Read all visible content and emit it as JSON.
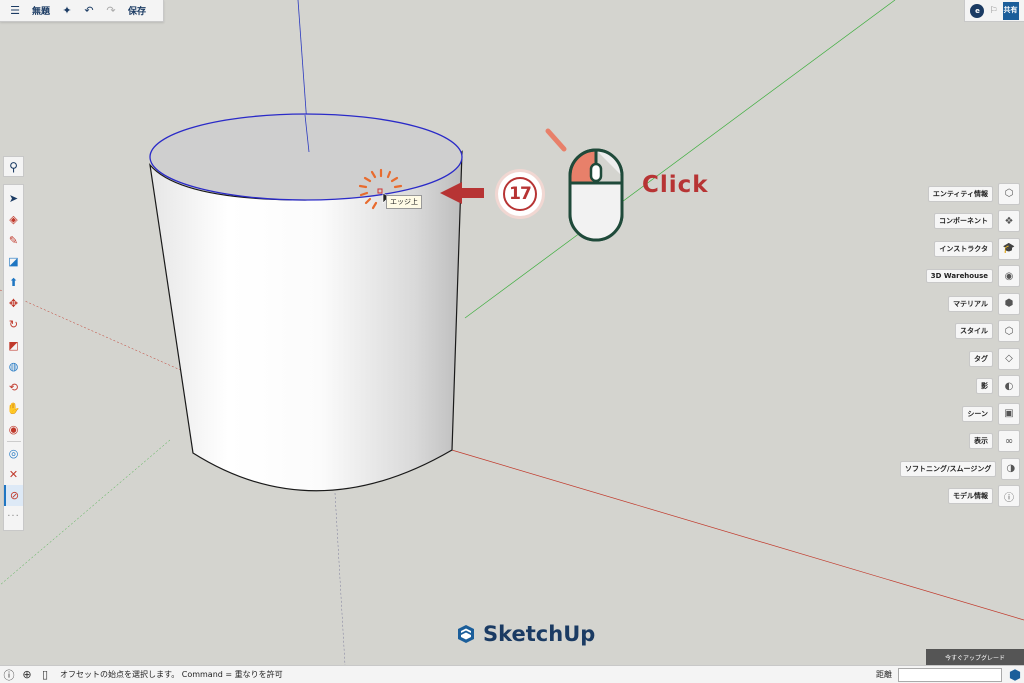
{
  "toolbar": {
    "menu_icon": "menu-icon",
    "title": "無題",
    "save_label": "保存"
  },
  "header_right": {
    "avatar_initial": "e",
    "share_label": "共有"
  },
  "left_tools": [
    {
      "name": "select-tool-icon",
      "glyph": "➤"
    },
    {
      "name": "eraser-tool-icon",
      "glyph": "◈"
    },
    {
      "name": "pencil-tool-icon",
      "glyph": "✎"
    },
    {
      "name": "rectangle-tool-icon",
      "glyph": "◪"
    },
    {
      "name": "push-pull-tool-icon",
      "glyph": "⬆"
    },
    {
      "name": "move-tool-icon",
      "glyph": "✥"
    },
    {
      "name": "rotate-tool-icon",
      "glyph": "↻"
    },
    {
      "name": "scale-tool-icon",
      "glyph": "◩"
    },
    {
      "name": "paint-bucket-tool-icon",
      "glyph": "◍"
    },
    {
      "name": "orbit-tool-icon",
      "glyph": "⟲"
    },
    {
      "name": "pan-tool-icon",
      "glyph": "✋"
    },
    {
      "name": "position-camera-icon",
      "glyph": "◉"
    },
    {
      "name": "tape-measure-icon",
      "glyph": "◎"
    },
    {
      "name": "zoom-extents-icon",
      "glyph": "✕"
    },
    {
      "name": "offset-tool-icon",
      "glyph": "⊘"
    }
  ],
  "right_panel": [
    {
      "label": "エンティティ情報",
      "icon": "entity-info-icon",
      "glyph": "⬡"
    },
    {
      "label": "コンポーネント",
      "icon": "components-icon",
      "glyph": "❖"
    },
    {
      "label": "インストラクタ",
      "icon": "instructor-icon",
      "glyph": "🎓"
    },
    {
      "label": "3D Warehouse",
      "icon": "3d-warehouse-icon",
      "glyph": "◉"
    },
    {
      "label": "マテリアル",
      "icon": "materials-icon",
      "glyph": "⬢"
    },
    {
      "label": "スタイル",
      "icon": "styles-icon",
      "glyph": "⬡"
    },
    {
      "label": "タグ",
      "icon": "tags-icon",
      "glyph": "◇"
    },
    {
      "label": "影",
      "icon": "shadows-icon",
      "glyph": "◐"
    },
    {
      "label": "シーン",
      "icon": "scenes-icon",
      "glyph": "▣"
    },
    {
      "label": "表示",
      "icon": "display-icon",
      "glyph": "∞"
    },
    {
      "label": "ソフトニング/スムージング",
      "icon": "soften-smooth-icon",
      "glyph": "◑"
    },
    {
      "label": "モデル情報",
      "icon": "model-info-icon",
      "glyph": "ⓘ"
    }
  ],
  "viewport": {
    "tooltip": "エッジ上",
    "step_number": "17",
    "click_label": "Click",
    "accent_color": "#b73434"
  },
  "branding": {
    "logo_text": "SketchUp"
  },
  "upgrade_label": "今すぐアップグレード",
  "status": {
    "message": "オフセットの始点を選択します。 Command = 重なりを許可",
    "measure_label": "距離",
    "measure_value": ""
  }
}
